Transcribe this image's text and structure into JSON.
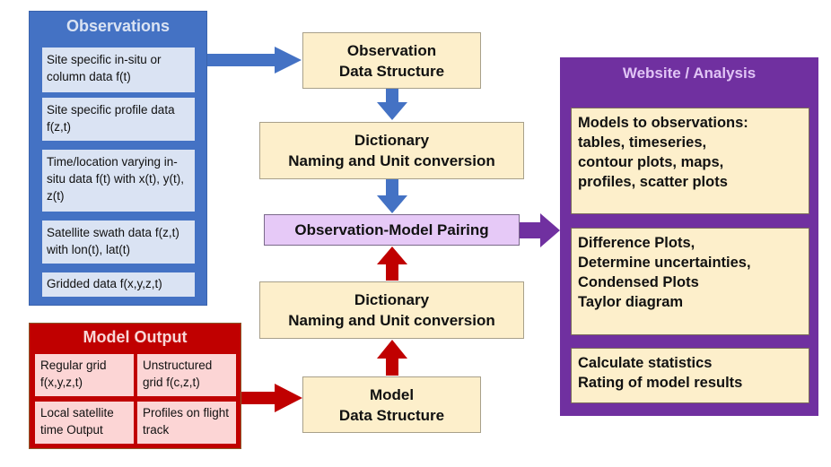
{
  "observations": {
    "title": "Observations",
    "items": [
      {
        "label": "Site specific in-situ or column data f(t)"
      },
      {
        "label": "Site specific profile data f(z,t)"
      },
      {
        "label": "Time/location varying in-situ data f(t) with x(t), y(t), z(t)"
      },
      {
        "label": "Satellite swath data f(z,t) with lon(t), lat(t)"
      },
      {
        "label": "Gridded data f(x,y,z,t)"
      }
    ]
  },
  "model_output": {
    "title": "Model Output",
    "cells": [
      {
        "label": "Regular grid f(x,y,z,t)"
      },
      {
        "label": "Unstructured grid f(c,z,t)"
      },
      {
        "label": "Local satellite time Output"
      },
      {
        "label": "Profiles on flight track"
      }
    ]
  },
  "flow": {
    "obs_structure": {
      "line1": "Observation",
      "line2": "Data Structure"
    },
    "obs_dictionary": {
      "line1": "Dictionary",
      "line2": "Naming and Unit conversion"
    },
    "pairing": {
      "label": "Observation-Model Pairing"
    },
    "model_dictionary": {
      "line1": "Dictionary",
      "line2": "Naming and Unit conversion"
    },
    "model_structure": {
      "line1": "Model",
      "line2": "Data Structure"
    }
  },
  "website": {
    "title": "Website / Analysis",
    "items": [
      {
        "lines": [
          "Models to observations:",
          "tables, timeseries,",
          "contour plots, maps,",
          "profiles, scatter plots"
        ]
      },
      {
        "lines": [
          "Difference Plots,",
          "Determine uncertainties,",
          "Condensed Plots",
          "Taylor diagram"
        ]
      },
      {
        "lines": [
          "Calculate statistics",
          "Rating of model results"
        ]
      }
    ]
  },
  "colors": {
    "observation_blue": "#4472c4",
    "model_red": "#c00000",
    "analysis_purple": "#7030a0",
    "flow_box_fill": "#fdefcb",
    "pairing_fill": "#e6c9f7"
  }
}
